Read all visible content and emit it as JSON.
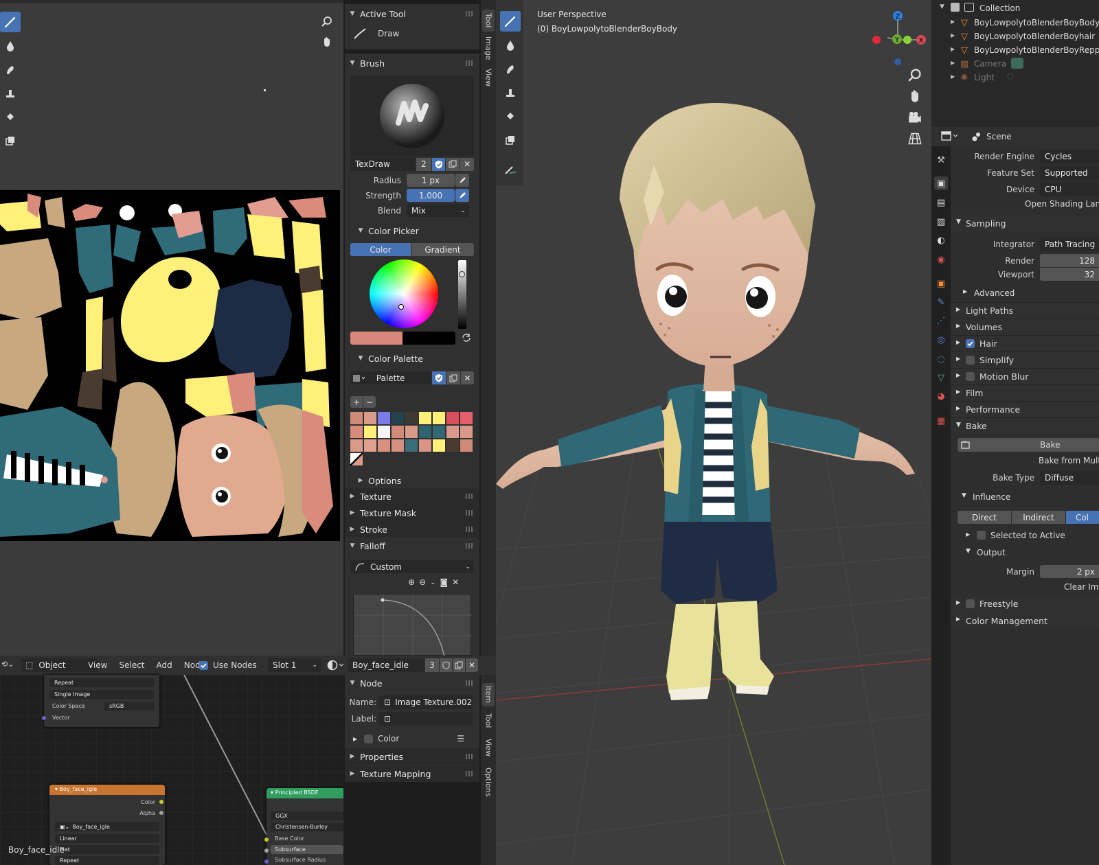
{
  "uv_editor": {
    "tools": [
      "brush-icon",
      "fill-icon",
      "smear-icon",
      "clone-icon",
      "soften-icon",
      "mask-icon"
    ]
  },
  "tool_sidebar": {
    "active_tool_header": "Active Tool",
    "active_tool_name": "Draw",
    "brush_header": "Brush",
    "brush_name": "TexDraw",
    "brush_users": "2",
    "radius_label": "Radius",
    "radius_value": "1 px",
    "strength_label": "Strength",
    "strength_value": "1.000",
    "blend_label": "Blend",
    "blend_value": "Mix",
    "color_picker_header": "Color Picker",
    "color_tab": "Color",
    "gradient_tab": "Gradient",
    "current_color": "#d9877a",
    "color_palette_header": "Color Palette",
    "palette_name": "Palette",
    "palette_colors": [
      "#d08a78",
      "#d99a88",
      "#7b7bea",
      "#25434f",
      "#3d3a36",
      "#fff07a",
      "#fff07a",
      "#d94f5e",
      "#e5606b",
      "#d98c7c",
      "#fff07a",
      "#f5f5f5",
      "#d38a77",
      "#d99a8a",
      "#2e6370",
      "#326875",
      "#d99a8a",
      "#d99a8a",
      "#d99a8a",
      "#e0a090",
      "#d9907f",
      "#d7907f",
      "#3a6d7a",
      "#d89484",
      "#fff07a",
      "#4a3b30",
      "#d08a78"
    ],
    "options": "Options",
    "texture": "Texture",
    "texture_mask": "Texture Mask",
    "stroke": "Stroke",
    "falloff": "Falloff",
    "falloff_preset": "Custom",
    "tabs": [
      "Tool",
      "Image",
      "View"
    ]
  },
  "viewport": {
    "perspective": "User Perspective",
    "object_label": "(0) BoyLowpolytoBlenderBoyBody"
  },
  "outliner": {
    "collection": "Collection",
    "items": [
      {
        "name": "BoyLowpolytoBlenderBoyBody",
        "dim": false
      },
      {
        "name": "BoyLowpolytoBlenderBoyhair",
        "dim": false
      },
      {
        "name": "BoyLowpolytoBlenderBoyReppu",
        "dim": false
      },
      {
        "name": "Camera",
        "dim": true
      },
      {
        "name": "Light",
        "dim": true
      }
    ]
  },
  "properties": {
    "scene_label": "Scene",
    "render_engine_label": "Render Engine",
    "render_engine": "Cycles",
    "feature_set_label": "Feature Set",
    "feature_set": "Supported",
    "device_label": "Device",
    "device": "CPU",
    "osl": "Open Shading Langua",
    "sampling": "Sampling",
    "integrator_label": "Integrator",
    "integrator": "Path Tracing",
    "render_label": "Render",
    "render_samples": "128",
    "viewport_label": "Viewport",
    "viewport_samples": "32",
    "advanced": "Advanced",
    "light_paths": "Light Paths",
    "volumes": "Volumes",
    "hair": "Hair",
    "simplify": "Simplify",
    "motion_blur": "Motion Blur",
    "film": "Film",
    "performance": "Performance",
    "bake": "Bake",
    "bake_button": "Bake",
    "bake_multires": "Bake from Multir",
    "bake_type_label": "Bake Type",
    "bake_type": "Diffuse",
    "influence": "Influence",
    "direct": "Direct",
    "indirect": "Indirect",
    "color_short": "Col",
    "selected_to_active": "Selected to Active",
    "output": "Output",
    "margin_label": "Margin",
    "margin_value": "2 px",
    "clear_image": "Clear Ima",
    "freestyle": "Freestyle",
    "color_management": "Color Management"
  },
  "node_editor": {
    "header": {
      "mode": "Object",
      "menu": [
        "View",
        "Select",
        "Add",
        "Node"
      ],
      "use_nodes": "Use Nodes",
      "slot": "Slot 1",
      "material": "Boy_face_idle",
      "users": "3"
    },
    "top_node": {
      "repeat": "Repeat",
      "single_image": "Single Image",
      "color_space_label": "Color Space",
      "color_space": "sRGB",
      "vector": "Vector"
    },
    "image_node": {
      "title": "Boy_face_igle",
      "color": "Color",
      "alpha": "Alpha",
      "image": "Boy_face_igle",
      "interp": "Linear",
      "proj": "Flat",
      "ext": "Repeat"
    },
    "bsdf_node": {
      "title": "Principled BSDF",
      "ggx": "GGX",
      "sss": "Christensen-Burley",
      "base_color": "Base Color",
      "subsurface": "Subsurface",
      "subsurface_radius": "Subsurface Radius"
    },
    "material_caption": "Boy_face_idle"
  },
  "node_sidebar": {
    "node_header": "Node",
    "name_label": "Name:",
    "name_value": "Image Texture.002",
    "label_label": "Label:",
    "color": "Color",
    "properties": "Properties",
    "texture_mapping": "Texture Mapping",
    "tabs": [
      "Item",
      "Tool",
      "View",
      "Options"
    ]
  }
}
